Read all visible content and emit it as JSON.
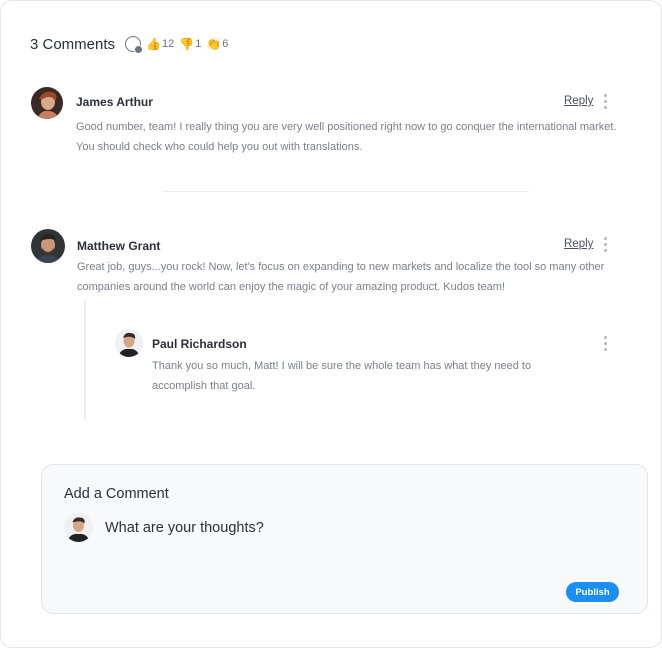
{
  "header": {
    "title": "3 Comments",
    "reactions": [
      {
        "icon": "thumbs-up-icon",
        "emoji": "👍",
        "count": "12"
      },
      {
        "icon": "thumbs-down-icon",
        "emoji": "👎",
        "count": "1"
      },
      {
        "icon": "clapping-hands-icon",
        "emoji": "👏",
        "count": "6"
      }
    ]
  },
  "comments": [
    {
      "author": "James Arthur",
      "reply_label": "Reply",
      "text_line1": "Good number, team! I really thing you are very well positioned right now to go conquer the international market.",
      "text_line2": "You should check who could help you out with translations."
    },
    {
      "author": "Matthew Grant",
      "reply_label": "Reply",
      "text_line1": "Great job, guys...you rock! Now, let's focus on expanding to new markets and localize the tool so many other",
      "text_line2": "companies around the world can enjoy the magic of your amazing product. Kudos team!"
    },
    {
      "author": "Paul Richardson",
      "text_line1": "Thank you so much, Matt! I will be sure the whole team has what they need to",
      "text_line2": "accomplish that goal."
    }
  ],
  "composer": {
    "title": "Add a Comment",
    "placeholder": "What are your thoughts?",
    "publish_label": "Publish"
  },
  "colors": {
    "accent": "#1b8ef2",
    "muted_text": "#7a7f89"
  }
}
